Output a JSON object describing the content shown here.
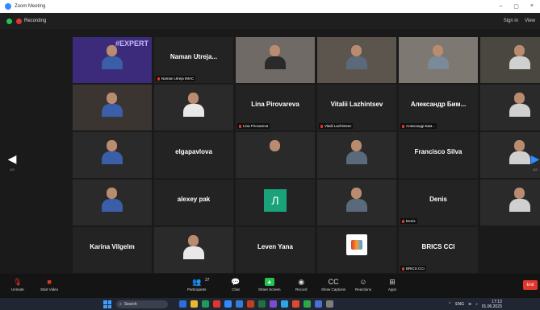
{
  "window": {
    "title": "Zoom Meeting",
    "controls": [
      "–",
      "▢",
      "×"
    ]
  },
  "meeting": {
    "recording_label": "Recording",
    "sign_in": "Sign in",
    "view_label": "View"
  },
  "pager": {
    "left_page": "1/2",
    "right_page": "1/2"
  },
  "tiles": [
    {
      "label": "",
      "big": "",
      "photo": true,
      "banner": "#EXPERT",
      "bg": "#3b2b7a"
    },
    {
      "label": "Naman Utreja IMAC",
      "big": "Naman Utreja...",
      "photo": false
    },
    {
      "label": "",
      "big": "",
      "photo": true,
      "bg": "#6f6a66"
    },
    {
      "label": "",
      "big": "",
      "photo": true,
      "bg": "#5c554e"
    },
    {
      "label": "",
      "big": "",
      "photo": true,
      "bg": "#7d7872"
    },
    {
      "label": "",
      "big": "",
      "photo": true,
      "bg": "#4a4640"
    },
    {
      "label": "",
      "big": "",
      "photo": true,
      "bg": "#3a3531"
    },
    {
      "label": "",
      "big": "",
      "photo": true,
      "active": true,
      "bg": "#2a2a2a"
    },
    {
      "label": "Lina Pirovareva",
      "big": "Lina Pirovareva",
      "photo": false
    },
    {
      "label": "Vitalii Lazhintsev",
      "big": "Vitalii Lazhintsev",
      "photo": false
    },
    {
      "label": "Александр Бим...",
      "big": "Александр Бим...",
      "photo": false
    },
    {
      "label": "",
      "big": "",
      "photo": true,
      "bg": "#2a2a2a"
    },
    {
      "label": "",
      "big": "",
      "photo": true,
      "bg": "#2a2a2a"
    },
    {
      "label": "",
      "big": "elgapavlova",
      "photo": false
    },
    {
      "label": "",
      "big": "",
      "photo": true,
      "bg": "#2a2a2a"
    },
    {
      "label": "",
      "big": "",
      "photo": true,
      "bg": "#2a2a2a"
    },
    {
      "label": "",
      "big": "Francisco Silva",
      "photo": false
    },
    {
      "label": "",
      "big": "",
      "photo": true,
      "bg": "#2a2a2a"
    },
    {
      "label": "",
      "big": "",
      "photo": true,
      "bg": "#2a2a2a"
    },
    {
      "label": "",
      "big": "alexey pak",
      "photo": false
    },
    {
      "label": "",
      "big": "Л",
      "photo": false,
      "avatar": "#1aa37a"
    },
    {
      "label": "",
      "big": "",
      "photo": true,
      "bg": "#2a2a2a"
    },
    {
      "label": "Denis",
      "big": "Denis",
      "photo": false
    },
    {
      "label": "",
      "big": "",
      "photo": true,
      "bg": "#2a2a2a"
    },
    {
      "label": "",
      "big": "Karina Vilgelm",
      "photo": false
    },
    {
      "label": "",
      "big": "",
      "photo": true,
      "bg": "#2a2a2a"
    },
    {
      "label": "",
      "big": "Leven Yana",
      "photo": false
    },
    {
      "label": "",
      "big": "",
      "photo": false,
      "logo": true
    },
    {
      "label": "BRICS CCI",
      "big": "BRICS CCI",
      "photo": false
    }
  ],
  "toolbar": {
    "unmute": "Unmute",
    "start_video": "Start Video",
    "participants": "Participants",
    "participants_count": "37",
    "chat": "Chat",
    "share_screen": "Share Screen",
    "record": "Record",
    "show_captions": "Show Captions",
    "reactions": "Reactions",
    "apps": "Apps",
    "end": "End"
  },
  "taskbar": {
    "search_placeholder": "Search",
    "time": "17:13",
    "date": "01.06.2023",
    "lang": "ENG"
  },
  "colors": {
    "accent": "#2d8cff",
    "record": "#e0362c",
    "share": "#23c552",
    "active_outline": "#d8e060"
  }
}
